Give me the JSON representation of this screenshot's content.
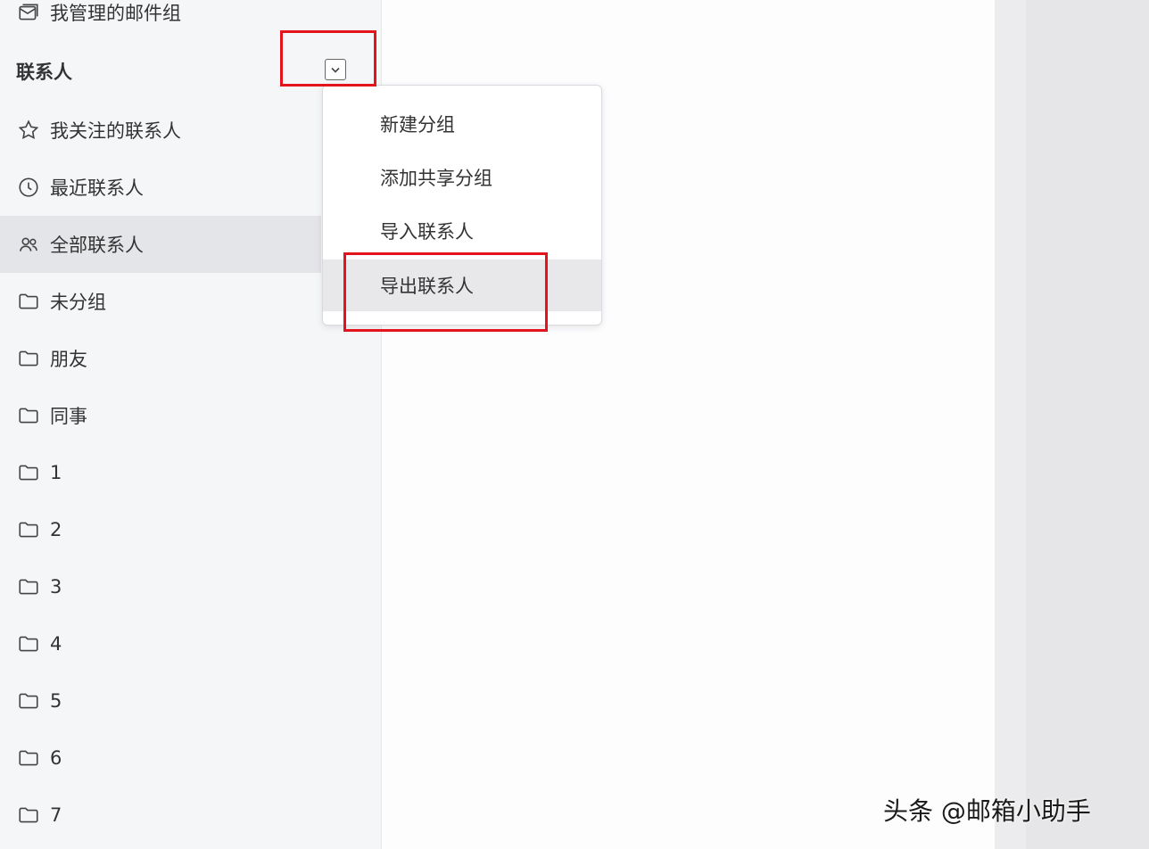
{
  "sidebar": {
    "top_item": {
      "label": "我管理的邮件组",
      "icon": "mail-group-icon"
    },
    "section_title": "联系人",
    "dropdown_icon": "chevron-down-icon",
    "items": [
      {
        "label": "我关注的联系人",
        "icon": "star-icon"
      },
      {
        "label": "最近联系人",
        "icon": "clock-icon"
      },
      {
        "label": "全部联系人",
        "icon": "users-icon",
        "active": true
      },
      {
        "label": "未分组",
        "icon": "folder-icon"
      },
      {
        "label": "朋友",
        "icon": "folder-icon"
      },
      {
        "label": "同事",
        "icon": "folder-icon"
      },
      {
        "label": "1",
        "icon": "folder-icon"
      },
      {
        "label": "2",
        "icon": "folder-icon"
      },
      {
        "label": "3",
        "icon": "folder-icon"
      },
      {
        "label": "4",
        "icon": "folder-icon"
      },
      {
        "label": "5",
        "icon": "folder-icon"
      },
      {
        "label": "6",
        "icon": "folder-icon"
      },
      {
        "label": "7",
        "icon": "folder-icon"
      }
    ]
  },
  "menu": {
    "items": [
      {
        "label": "新建分组"
      },
      {
        "label": "添加共享分组"
      },
      {
        "label": "导入联系人"
      },
      {
        "label": "导出联系人",
        "hovered": true
      }
    ]
  },
  "colors": {
    "highlight": "#e3141b",
    "sidebar_bg": "#f5f6f8",
    "active_bg": "#e4e5e8"
  },
  "watermark": "头条 @邮箱小助手"
}
